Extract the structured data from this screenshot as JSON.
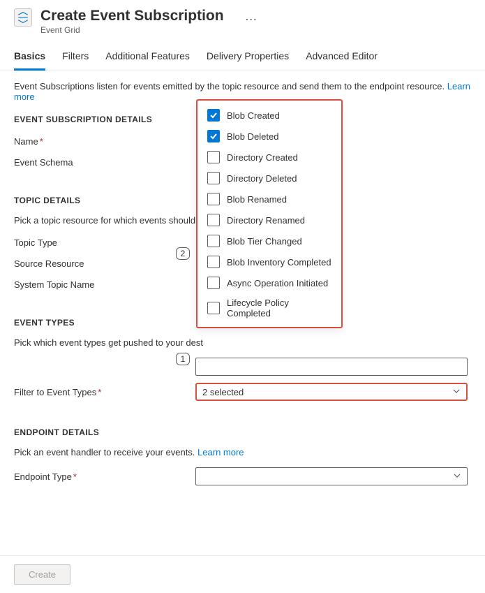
{
  "header": {
    "title": "Create Event Subscription",
    "subtitle": "Event Grid",
    "ellipsis": "…"
  },
  "tabs": {
    "basics": "Basics",
    "filters": "Filters",
    "additional": "Additional Features",
    "delivery": "Delivery Properties",
    "advanced": "Advanced Editor"
  },
  "intro": {
    "text": "Event Subscriptions listen for events emitted by the topic resource and send them to the endpoint resource. ",
    "learn_more": "Learn more"
  },
  "sections": {
    "subscription_details": "EVENT SUBSCRIPTION DETAILS",
    "topic_details": "TOPIC DETAILS",
    "event_types": "EVENT TYPES",
    "endpoint_details": "ENDPOINT DETAILS"
  },
  "labels": {
    "name": "Name",
    "event_schema": "Event Schema",
    "topic_desc": "Pick a topic resource for which events should b",
    "topic_type": "Topic Type",
    "source_resource": "Source Resource",
    "system_topic_name": "System Topic Name",
    "event_types_desc": "Pick which event types get pushed to your dest",
    "filter_to_event_types": "Filter to Event Types",
    "endpoint_desc": "Pick an event handler to receive your events. ",
    "endpoint_desc_link": "Learn more",
    "endpoint_type": "Endpoint Type"
  },
  "filter_dropdown": {
    "selected_text": "2 selected",
    "options": [
      {
        "label": "Blob Created",
        "checked": true
      },
      {
        "label": "Blob Deleted",
        "checked": true
      },
      {
        "label": "Directory Created",
        "checked": false
      },
      {
        "label": "Directory Deleted",
        "checked": false
      },
      {
        "label": "Blob Renamed",
        "checked": false
      },
      {
        "label": "Directory Renamed",
        "checked": false
      },
      {
        "label": "Blob Tier Changed",
        "checked": false
      },
      {
        "label": "Blob Inventory Completed",
        "checked": false
      },
      {
        "label": "Async Operation Initiated",
        "checked": false
      },
      {
        "label": "Lifecycle Policy Completed",
        "checked": false
      }
    ]
  },
  "annotations": {
    "step1": "1",
    "step2": "2"
  },
  "footer": {
    "create": "Create"
  }
}
